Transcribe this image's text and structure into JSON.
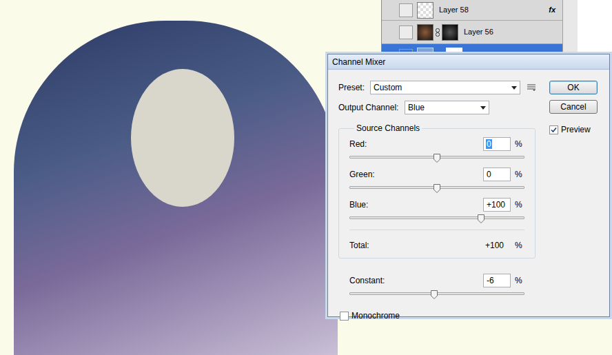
{
  "layers_panel": {
    "layers": [
      {
        "name": "Layer 58",
        "visible": false,
        "selected": false,
        "fx": "fx",
        "kind": "plain"
      },
      {
        "name": "Layer 56",
        "visible": false,
        "selected": false,
        "kind": "masked"
      },
      {
        "visible": true,
        "selected": true,
        "kind": "adjustment"
      }
    ]
  },
  "dialog": {
    "title": "Channel Mixer",
    "preset": {
      "label": "Preset:",
      "value": "Custom"
    },
    "output_channel": {
      "label": "Output Channel:",
      "value": "Blue"
    },
    "buttons": [
      {
        "label": "OK",
        "default": true
      },
      {
        "label": "Cancel",
        "default": false
      }
    ],
    "preview": {
      "label": "Preview",
      "checked": true
    },
    "source_channels": {
      "title": "Source Channels",
      "channels": [
        {
          "name": "Red:",
          "value": "0",
          "unit": "%",
          "level": 0.5,
          "focused": true
        },
        {
          "name": "Green:",
          "value": "0",
          "unit": "%",
          "level": 0.5,
          "focused": false
        },
        {
          "name": "Blue:",
          "value": "+100",
          "unit": "%",
          "level": 0.75,
          "focused": false
        }
      ],
      "total": {
        "label": "Total:",
        "value": "+100",
        "unit": "%"
      }
    },
    "constant": {
      "label": "Constant:",
      "value": "-6",
      "unit": "%",
      "level": 0.485
    },
    "monochrome": {
      "label": "Monochrome",
      "checked": false
    }
  }
}
